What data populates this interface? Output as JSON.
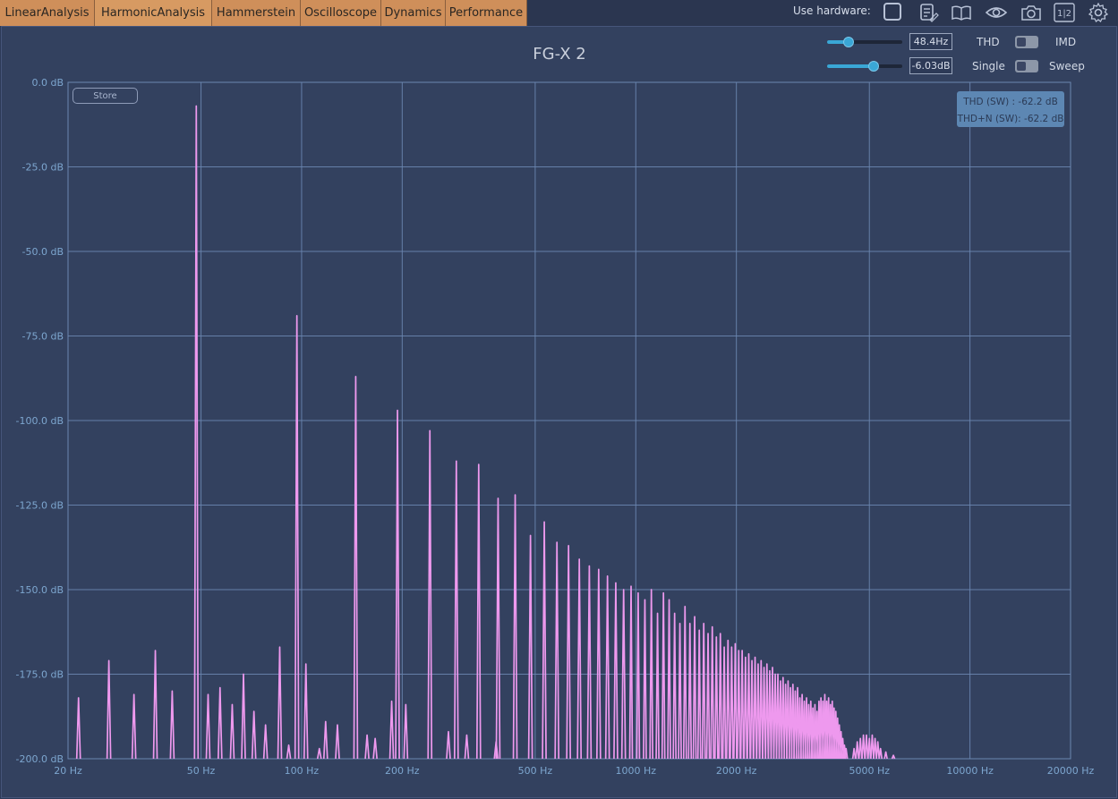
{
  "tabs": [
    {
      "label": "LinearAnalysis",
      "active": false
    },
    {
      "label": "HarmonicAnalysis",
      "active": true
    },
    {
      "label": "Hammerstein",
      "active": false
    },
    {
      "label": "Oscilloscope",
      "active": false
    },
    {
      "label": "Dynamics",
      "active": false
    },
    {
      "label": "Performance",
      "active": false
    }
  ],
  "toolbar": {
    "use_hardware_label": "Use hardware:",
    "icons": [
      "hardware-checkbox-icon",
      "notes-icon",
      "book-icon",
      "eye-icon",
      "camera-icon",
      "channel-1-2-icon",
      "gear-icon"
    ],
    "channel_text": "1|2"
  },
  "plot": {
    "title": "FG-X 2",
    "store_label": "Store",
    "frequency": {
      "value": "48.4Hz",
      "slider_fraction": 0.29
    },
    "level": {
      "value": "-6.03dB",
      "slider_fraction": 0.62
    },
    "mode_toggle": {
      "left": "THD",
      "right": "IMD"
    },
    "run_toggle": {
      "left": "Single",
      "right": "Sweep"
    },
    "metrics": [
      "THD (SW) : -62.2 dB",
      "THD+N (SW): -62.2 dB"
    ]
  },
  "colors": {
    "background": "#33415f",
    "grid": "#6b86b0",
    "trace": "#ee99ee",
    "tab": "#cf8f5a",
    "accent": "#3aa7d6"
  },
  "chart_data": {
    "type": "line",
    "x_scale": "log",
    "xlim": [
      20,
      20000
    ],
    "ylim": [
      -200,
      0
    ],
    "x_ticks": [
      {
        "v": 20,
        "label": "20 Hz"
      },
      {
        "v": 50,
        "label": "50 Hz"
      },
      {
        "v": 100,
        "label": "100 Hz"
      },
      {
        "v": 200,
        "label": "200 Hz"
      },
      {
        "v": 500,
        "label": "500 Hz"
      },
      {
        "v": 1000,
        "label": "1000 Hz"
      },
      {
        "v": 2000,
        "label": "2000 Hz"
      },
      {
        "v": 5000,
        "label": "5000 Hz"
      },
      {
        "v": 10000,
        "label": "10000 Hz"
      },
      {
        "v": 20000,
        "label": "20000 Hz"
      }
    ],
    "y_ticks": [
      {
        "v": 0,
        "label": "0.0 dB"
      },
      {
        "v": -25,
        "label": "-25.0 dB"
      },
      {
        "v": -50,
        "label": "-50.0 dB"
      },
      {
        "v": -75,
        "label": "-75.0 dB"
      },
      {
        "v": -100,
        "label": "-100.0 dB"
      },
      {
        "v": -125,
        "label": "-125.0 dB"
      },
      {
        "v": -150,
        "label": "-150.0 dB"
      },
      {
        "v": -175,
        "label": "-175.0 dB"
      },
      {
        "v": -200,
        "label": "-200.0 dB"
      }
    ],
    "grid": true,
    "peaks": [
      [
        21.5,
        -182
      ],
      [
        26.5,
        -171
      ],
      [
        31.5,
        -181
      ],
      [
        36.5,
        -168
      ],
      [
        41,
        -180
      ],
      [
        48.4,
        -7
      ],
      [
        52.5,
        -181
      ],
      [
        57,
        -179
      ],
      [
        62,
        -184
      ],
      [
        67,
        -175
      ],
      [
        72,
        -186
      ],
      [
        78,
        -190
      ],
      [
        86,
        -167
      ],
      [
        91.5,
        -196
      ],
      [
        96.8,
        -69
      ],
      [
        103,
        -172
      ],
      [
        113,
        -197
      ],
      [
        118,
        -189
      ],
      [
        128,
        -190
      ],
      [
        145.2,
        -87
      ],
      [
        157,
        -193
      ],
      [
        166,
        -194
      ],
      [
        186,
        -183
      ],
      [
        193.6,
        -97
      ],
      [
        205,
        -184
      ],
      [
        242,
        -103
      ],
      [
        275,
        -192
      ],
      [
        290.4,
        -112
      ],
      [
        312,
        -193
      ],
      [
        338.8,
        -113
      ],
      [
        382,
        -195
      ],
      [
        387.2,
        -123
      ],
      [
        435.6,
        -122
      ],
      [
        484,
        -134
      ],
      [
        532.4,
        -130
      ],
      [
        580.8,
        -136
      ],
      [
        629.2,
        -137
      ],
      [
        677.6,
        -141
      ],
      [
        726,
        -143
      ],
      [
        774.4,
        -144
      ],
      [
        822.8,
        -146
      ],
      [
        871.2,
        -148
      ],
      [
        919.6,
        -150
      ],
      [
        968,
        -149
      ],
      [
        1016.4,
        -151
      ],
      [
        1064.8,
        -153
      ],
      [
        1113.2,
        -150
      ],
      [
        1161.6,
        -157
      ],
      [
        1210,
        -151
      ],
      [
        1258.4,
        -153
      ],
      [
        1306.8,
        -157
      ],
      [
        1355.2,
        -160
      ],
      [
        1403.6,
        -155
      ],
      [
        1452,
        -160
      ],
      [
        1500.4,
        -158
      ],
      [
        1548.8,
        -162
      ],
      [
        1597.2,
        -160
      ],
      [
        1645.6,
        -163
      ],
      [
        1694,
        -161
      ],
      [
        1742.4,
        -164
      ],
      [
        1790.8,
        -163
      ],
      [
        1839.2,
        -167
      ],
      [
        1887.6,
        -165
      ],
      [
        1936,
        -167
      ],
      [
        1984.4,
        -166
      ],
      [
        2032.8,
        -168
      ],
      [
        2081.2,
        -168
      ],
      [
        2129.6,
        -170
      ],
      [
        2178,
        -169
      ],
      [
        2226.4,
        -171
      ],
      [
        2274.8,
        -170
      ],
      [
        2323.2,
        -172
      ],
      [
        2371.6,
        -171
      ],
      [
        2420,
        -173
      ],
      [
        2468.4,
        -172
      ],
      [
        2516.8,
        -174
      ],
      [
        2565.2,
        -173
      ],
      [
        2613.6,
        -175
      ],
      [
        2662,
        -175
      ],
      [
        2710.4,
        -177
      ],
      [
        2758.8,
        -176
      ],
      [
        2807.2,
        -178
      ],
      [
        2855.6,
        -177
      ],
      [
        2904,
        -179
      ],
      [
        2952.4,
        -178
      ],
      [
        3000.8,
        -180
      ],
      [
        3049.2,
        -179
      ],
      [
        3097.6,
        -182
      ],
      [
        3146,
        -181
      ],
      [
        3194.4,
        -183
      ],
      [
        3242.8,
        -182
      ],
      [
        3291.2,
        -184
      ],
      [
        3339.6,
        -183
      ],
      [
        3388,
        -185
      ],
      [
        3436.4,
        -184
      ],
      [
        3484.8,
        -186
      ],
      [
        3533.2,
        -183
      ],
      [
        3581.6,
        -182
      ],
      [
        3630,
        -183
      ],
      [
        3678.4,
        -181
      ],
      [
        3726.8,
        -183
      ],
      [
        3775.2,
        -182
      ],
      [
        3823.6,
        -184
      ],
      [
        3872,
        -183
      ],
      [
        3920.4,
        -185
      ],
      [
        3968.8,
        -186
      ],
      [
        4017.2,
        -188
      ],
      [
        4065.6,
        -190
      ],
      [
        4114,
        -192
      ],
      [
        4162.4,
        -194
      ],
      [
        4210.8,
        -196
      ],
      [
        4259.2,
        -197
      ],
      [
        4500,
        -197
      ],
      [
        4600,
        -195
      ],
      [
        4700,
        -194
      ],
      [
        4800,
        -193
      ],
      [
        4900,
        -193
      ],
      [
        5000,
        -194
      ],
      [
        5100,
        -193
      ],
      [
        5200,
        -194
      ],
      [
        5300,
        -195
      ],
      [
        5400,
        -197
      ],
      [
        5600,
        -198
      ],
      [
        5900,
        -199
      ]
    ]
  }
}
